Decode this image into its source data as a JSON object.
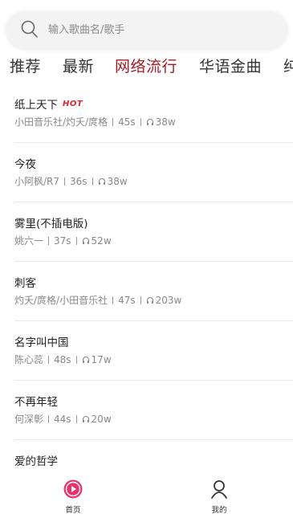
{
  "search": {
    "placeholder": "输入歌曲名/歌手"
  },
  "tabs": [
    {
      "label": "推荐"
    },
    {
      "label": "最新"
    },
    {
      "label": "网络流行"
    },
    {
      "label": "华语金曲"
    },
    {
      "label": "纯"
    }
  ],
  "active_tab": "网络流行",
  "songs": [
    {
      "title": "纸上天下",
      "badge": "HOT",
      "artist": "小田音乐社/灼夭/庹格",
      "duration": "45s",
      "plays": "38w"
    },
    {
      "title": "今夜",
      "artist": "小阿枫/R7",
      "duration": "36s",
      "plays": "38w"
    },
    {
      "title": "雾里(不插电版)",
      "artist": "姚六一",
      "duration": "37s",
      "plays": "52w"
    },
    {
      "title": "刺客",
      "artist": "灼夭/庹格/小田音乐社",
      "duration": "47s",
      "plays": "203w"
    },
    {
      "title": "名字叫中国",
      "artist": "陈心蕊",
      "duration": "48s",
      "plays": "17w"
    },
    {
      "title": "不再年轻",
      "artist": "何深彰",
      "duration": "44s",
      "plays": "20w"
    },
    {
      "title": "爱的哲学"
    }
  ],
  "bottom_nav": {
    "home_label": "首页",
    "mine_label": "我的"
  },
  "colors": {
    "accent": "#a51b23",
    "hot": "#e0252f",
    "home_icon": "#e8336b"
  },
  "icons": {
    "search": "search-icon",
    "headphone": "headphone-icon",
    "home": "play-circle-icon",
    "mine": "person-icon"
  }
}
